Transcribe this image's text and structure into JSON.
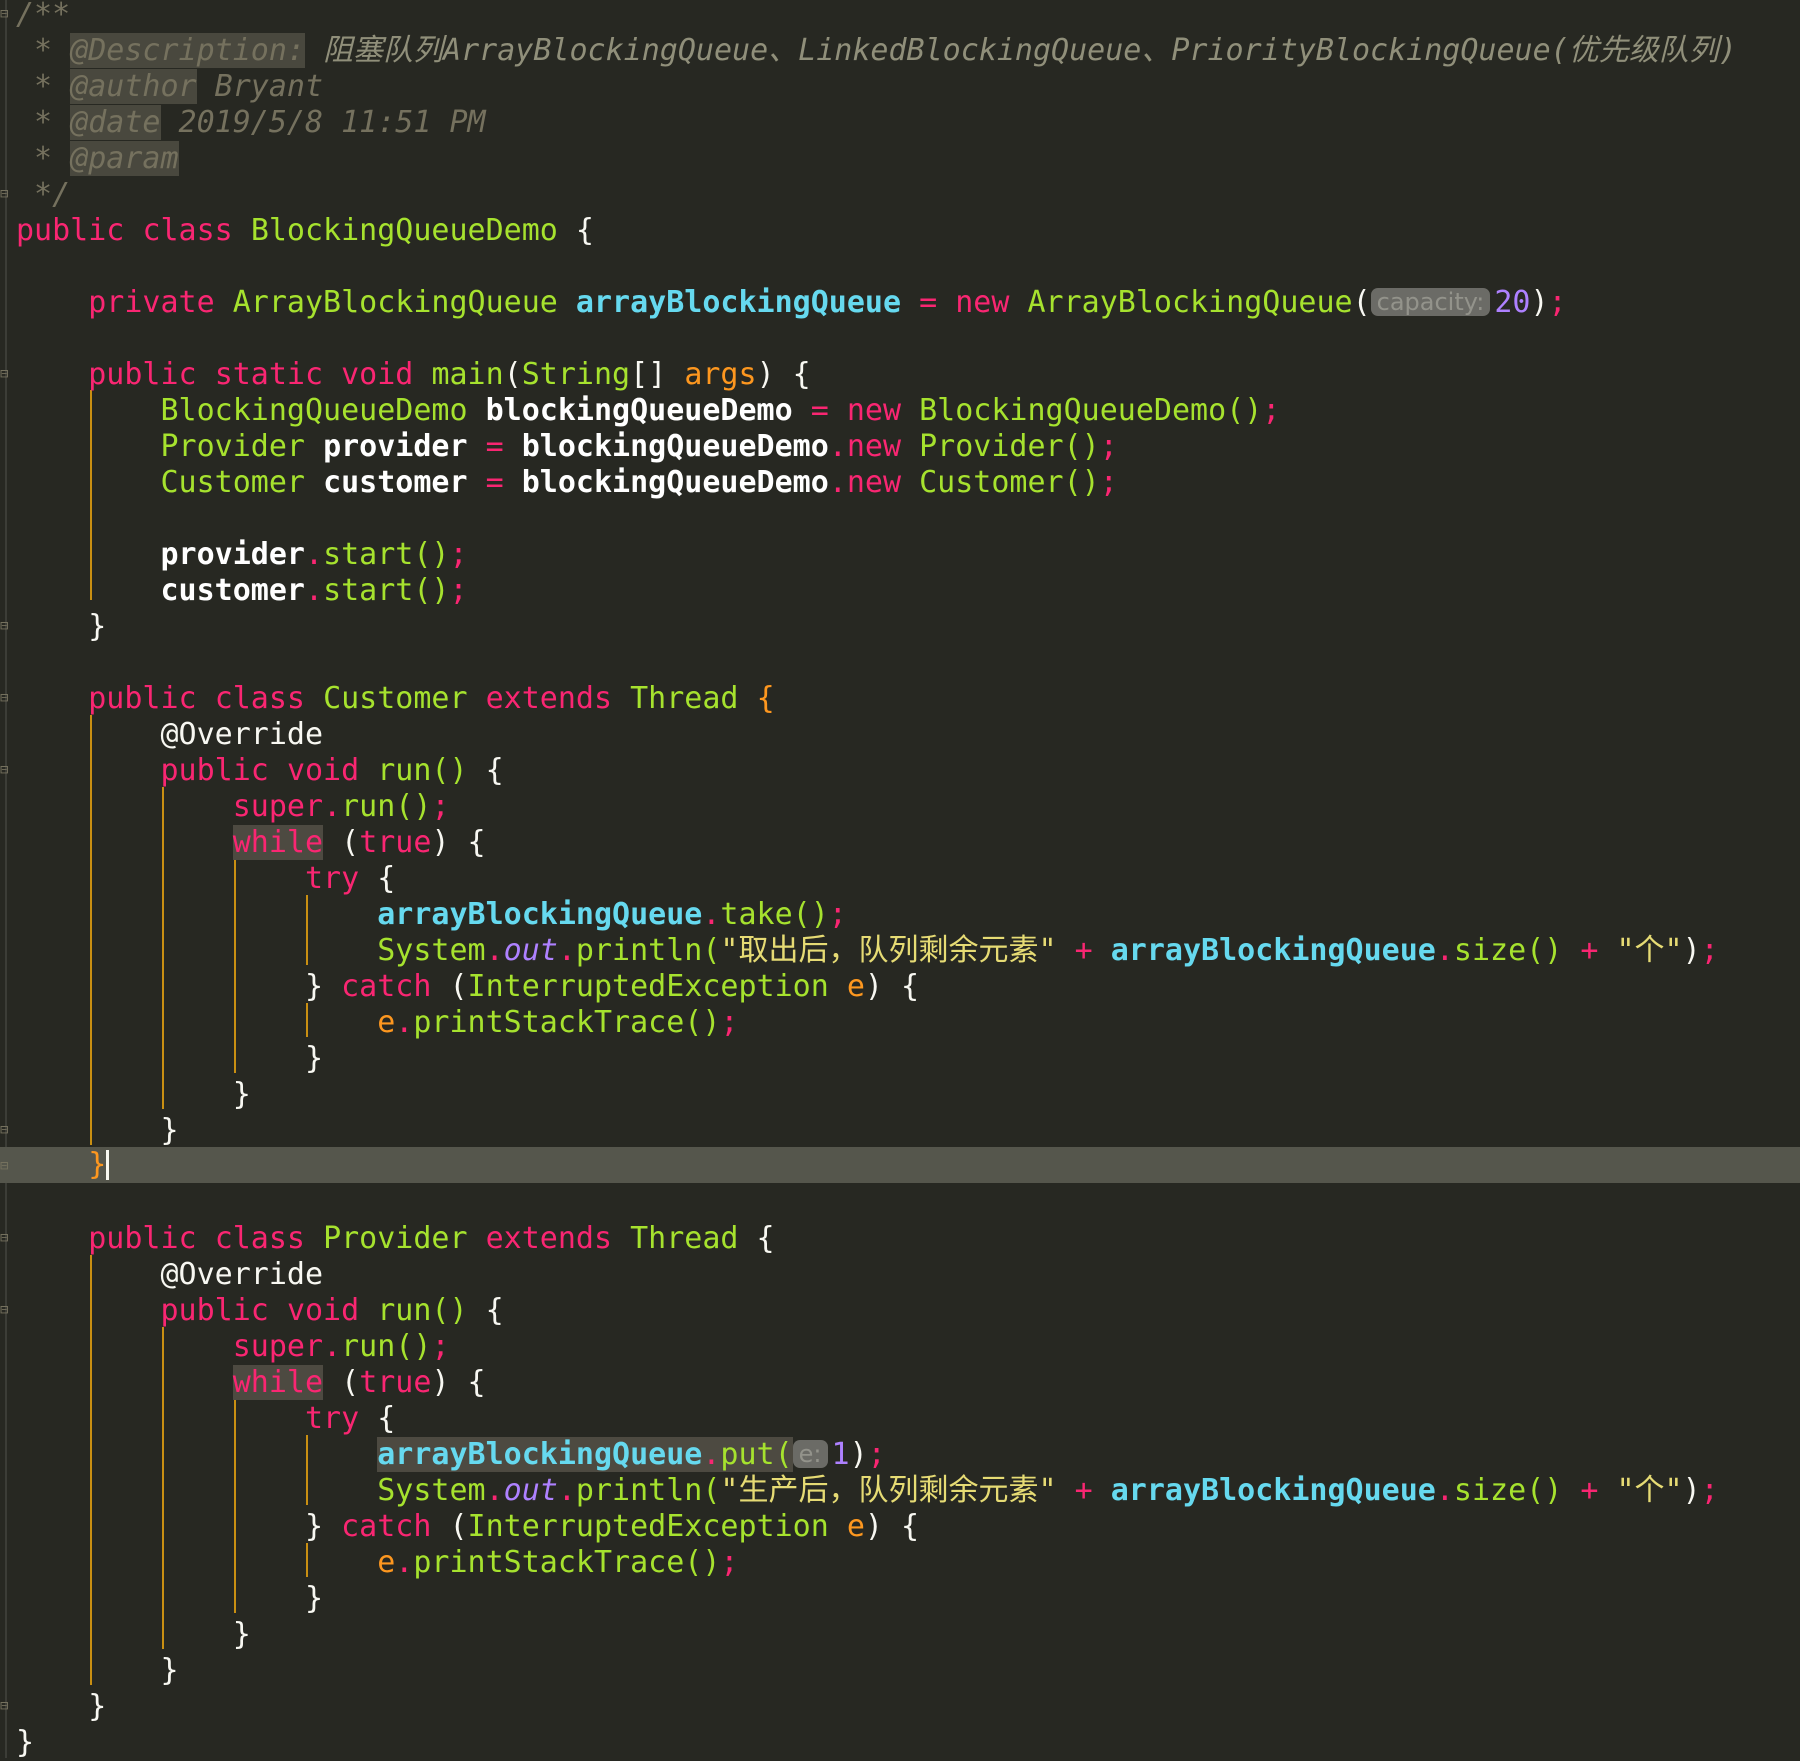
{
  "code": {
    "comment_open": "/**",
    "comment_star": " * ",
    "comment_close": " */",
    "tag_description": "@Description:",
    "description_text": " 阻塞队列ArrayBlockingQueue、LinkedBlockingQueue、PriorityBlockingQueue(优先级队列)",
    "tag_author": "@author",
    "author_text": " Bryant",
    "tag_date": "@date",
    "date_text": " 2019/5/8 11:51 PM",
    "tag_param": "@param",
    "kw_public": "public",
    "kw_class": "class",
    "kw_private": "private",
    "kw_static": "static",
    "kw_void": "void",
    "kw_new": "new",
    "kw_extends": "extends",
    "kw_super": "super",
    "kw_while": "while",
    "kw_true": "true",
    "kw_try": "try",
    "kw_catch": "catch",
    "class_name": "BlockingQueueDemo",
    "type_abq": "ArrayBlockingQueue",
    "type_string": "String",
    "type_provider": "Provider",
    "type_customer": "Customer",
    "type_thread": "Thread",
    "type_exception": "InterruptedException",
    "field_abq": "arrayBlockingQueue",
    "hint_capacity": "capacity:",
    "hint_e": "e:",
    "num_20": "20",
    "num_1": "1",
    "fn_main": "main",
    "param_args": "args",
    "var_demo": "blockingQueueDemo",
    "var_provider": "provider",
    "var_customer": "customer",
    "ctor_demo": "BlockingQueueDemo()",
    "ctor_provider": "Provider()",
    "ctor_customer": "Customer()",
    "call_start": "start()",
    "annotation_override": "@Override",
    "fn_run": "run()",
    "call_take": "take()",
    "call_put": "put(",
    "sys": "System",
    "out": "out",
    "println": "println(",
    "str_take": "\"取出后，队列剩余元素\"",
    "str_put": "\"生产后，队列剩余元素\"",
    "call_size": "size()",
    "str_ge": "\"个\"",
    "var_e": "e",
    "call_trace": "printStackTrace()"
  }
}
